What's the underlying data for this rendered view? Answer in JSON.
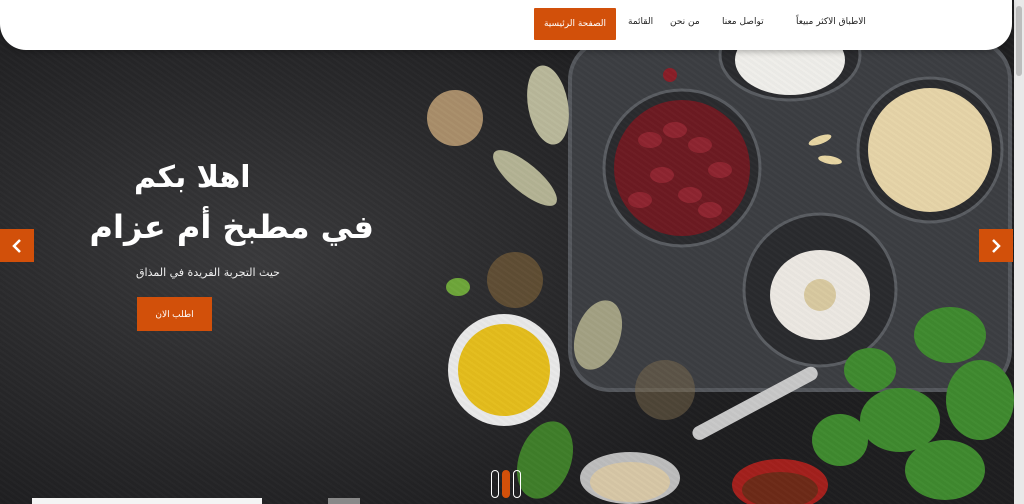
{
  "nav": {
    "items": [
      {
        "label": "الاطباق الاكثر مبيعاً",
        "name": "nav-best-sellers"
      },
      {
        "label": "تواصل معنا",
        "name": "nav-contact"
      },
      {
        "label": "من نحن",
        "name": "nav-about"
      },
      {
        "label": "القائمة",
        "name": "nav-menu"
      }
    ],
    "active_label": "الصفحة الرئيسية"
  },
  "hero": {
    "title_line1": "اهلا بكم",
    "title_line2": "في مطبخ أم عزام",
    "subtitle": "حيث التجربة الفريدة في المذاق",
    "cta_label": "اطلب الان"
  },
  "carousel": {
    "prev_icon": "chevron-left-icon",
    "next_icon": "chevron-right-icon",
    "slide_count": 3,
    "active_index": 1
  },
  "colors": {
    "accent": "#d2500a",
    "navbar_bg": "#ffffff"
  }
}
